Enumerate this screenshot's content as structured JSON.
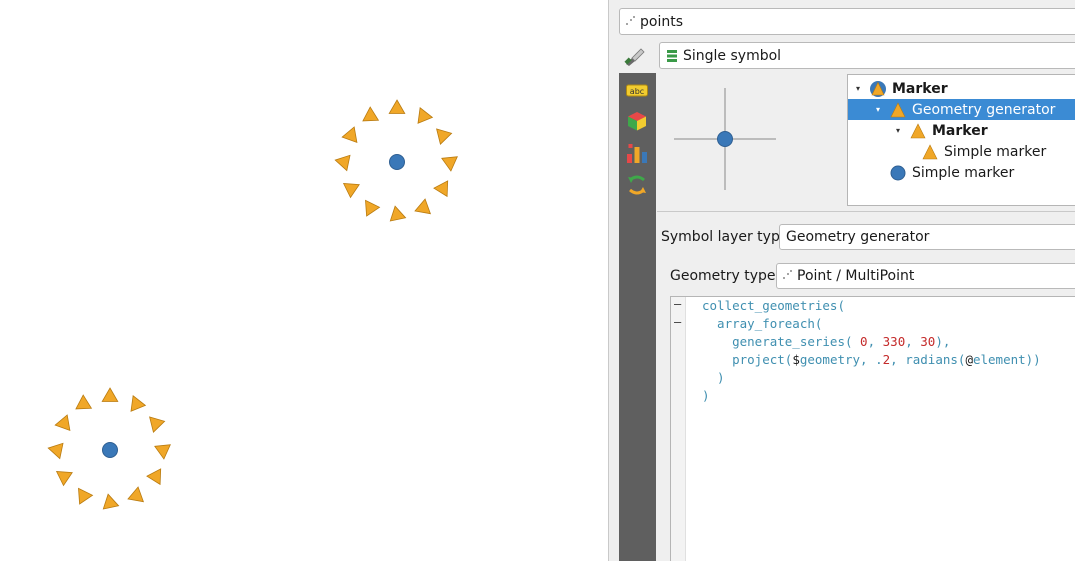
{
  "layer_combo": {
    "value": "points"
  },
  "renderer": {
    "value": "Single symbol"
  },
  "symbol_tree": {
    "items": [
      {
        "label": "Marker",
        "bold": true,
        "expanded": true,
        "icon": "marker-triangle-icon"
      },
      {
        "label": "Geometry generator",
        "bold": false,
        "expanded": true,
        "selected": true,
        "icon": "triangle-icon"
      },
      {
        "label": "Marker",
        "bold": true,
        "expanded": true,
        "icon": "triangle-icon"
      },
      {
        "label": "Simple marker",
        "bold": false,
        "icon": "triangle-icon"
      },
      {
        "label": "Simple marker",
        "bold": false,
        "icon": "circle-icon"
      }
    ]
  },
  "symbol_layer_type": {
    "label": "Symbol layer type",
    "value": "Geometry generator"
  },
  "geometry_type": {
    "label": "Geometry type",
    "value": "Point / MultiPoint"
  },
  "expression": {
    "lines": [
      "collect_geometries(",
      "  array_foreach(",
      "    generate_series( 0, 330, 30),",
      "    project($geometry, .2, radians(@element))",
      "  )",
      ")"
    ]
  },
  "map": {
    "point_groups": 2,
    "markers_per_group": 12,
    "series": {
      "start": 0,
      "stop": 330,
      "step": 30
    },
    "marker_fill": "#f0a728",
    "point_fill": "#3a78b8"
  },
  "colors": {
    "selection": "#3b8bd4",
    "code_function": "#3f8fb0",
    "code_number": "#c42b2b"
  }
}
